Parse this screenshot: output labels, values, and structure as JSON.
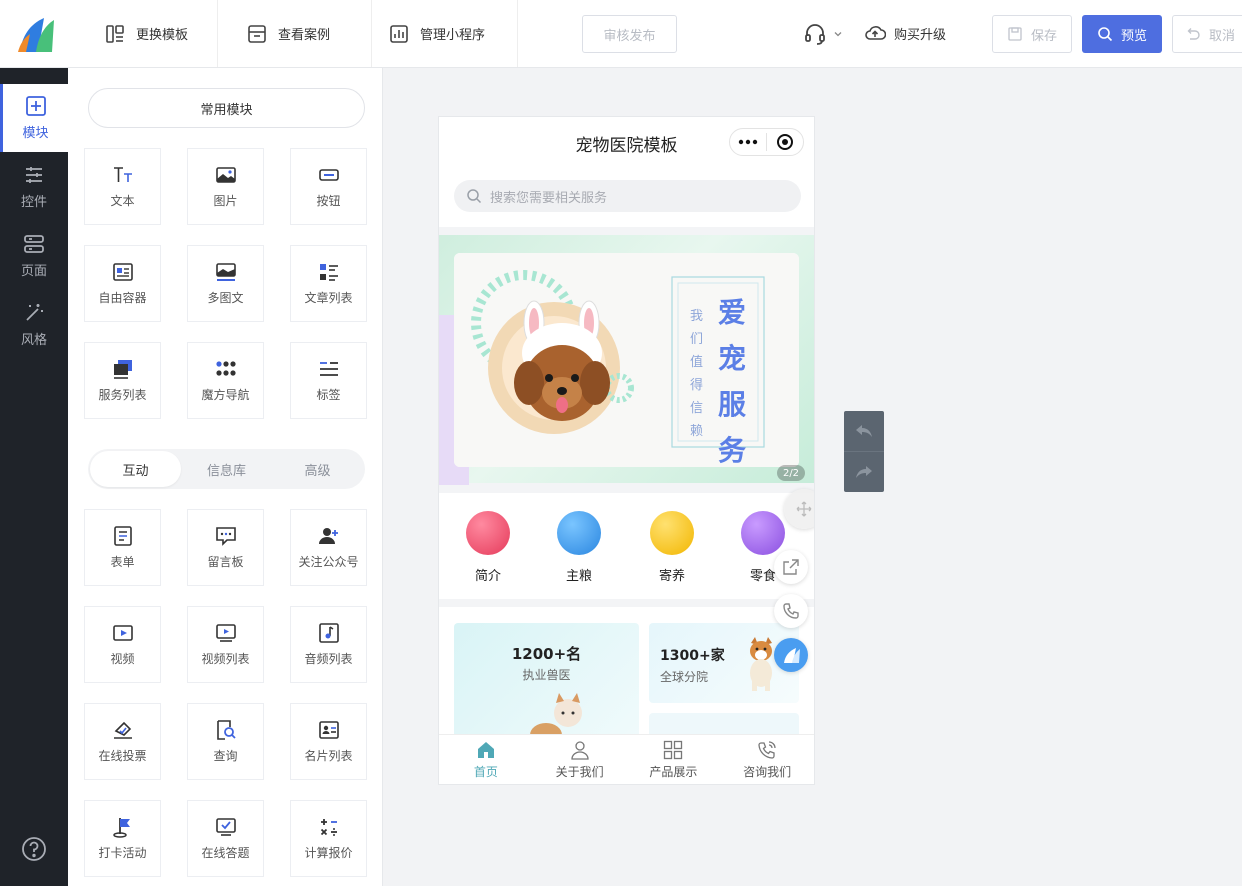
{
  "topbar": {
    "change_template": "更换模板",
    "view_cases": "查看案例",
    "manage_miniapp": "管理小程序",
    "audit_publish": "审核发布",
    "upgrade": "购买升级",
    "save": "保存",
    "preview": "预览",
    "cancel": "取消"
  },
  "leftnav": {
    "items": [
      {
        "label": "模块",
        "icon": "plus-square-icon"
      },
      {
        "label": "控件",
        "icon": "sliders-icon"
      },
      {
        "label": "页面",
        "icon": "pages-icon"
      },
      {
        "label": "风格",
        "icon": "magic-wand-icon"
      }
    ]
  },
  "panel": {
    "common_title": "常用模块",
    "common_modules": [
      {
        "label": "文本",
        "icon": "text-icon"
      },
      {
        "label": "图片",
        "icon": "image-icon"
      },
      {
        "label": "按钮",
        "icon": "button-icon"
      },
      {
        "label": "自由容器",
        "icon": "container-icon"
      },
      {
        "label": "多图文",
        "icon": "multi-image-text-icon"
      },
      {
        "label": "文章列表",
        "icon": "article-list-icon"
      },
      {
        "label": "服务列表",
        "icon": "service-list-icon"
      },
      {
        "label": "魔方导航",
        "icon": "cube-nav-icon"
      },
      {
        "label": "标签",
        "icon": "tag-icon"
      }
    ],
    "tabs": [
      "互动",
      "信息库",
      "高级"
    ],
    "interactive_modules": [
      {
        "label": "表单",
        "icon": "form-icon"
      },
      {
        "label": "留言板",
        "icon": "message-board-icon"
      },
      {
        "label": "关注公众号",
        "icon": "follow-account-icon"
      },
      {
        "label": "视频",
        "icon": "video-icon"
      },
      {
        "label": "视频列表",
        "icon": "video-list-icon"
      },
      {
        "label": "音频列表",
        "icon": "audio-list-icon"
      },
      {
        "label": "在线投票",
        "icon": "vote-icon"
      },
      {
        "label": "查询",
        "icon": "query-icon"
      },
      {
        "label": "名片列表",
        "icon": "card-list-icon"
      },
      {
        "label": "打卡活动",
        "icon": "checkin-flag-icon"
      },
      {
        "label": "在线答题",
        "icon": "quiz-icon"
      },
      {
        "label": "计算报价",
        "icon": "calculator-icon"
      }
    ]
  },
  "phone": {
    "title": "宠物医院模板",
    "search_placeholder": "搜索您需要相关服务",
    "banner": {
      "headline": [
        "爱",
        "宠",
        "服",
        "务"
      ],
      "subline": [
        "我",
        "们",
        "值",
        "得",
        "信",
        "赖"
      ],
      "pager": "2/2"
    },
    "nav": [
      {
        "label": "简介",
        "color": "#f0506a"
      },
      {
        "label": "主粮",
        "color": "#3a9ef0"
      },
      {
        "label": "寄养",
        "color": "#f7c31c"
      },
      {
        "label": "零食",
        "color": "#9a5ce6"
      }
    ],
    "stats": [
      {
        "value": "1200+名",
        "label": "执业兽医"
      },
      {
        "value": "1300+家",
        "label": "全球分院"
      }
    ],
    "tabbar": [
      "首页",
      "关于我们",
      "产品展示",
      "咨询我们"
    ]
  },
  "colors": {
    "primary": "#4e6ee0",
    "sidebar": "#1f2329",
    "accent_teal": "#4fa8b6"
  }
}
